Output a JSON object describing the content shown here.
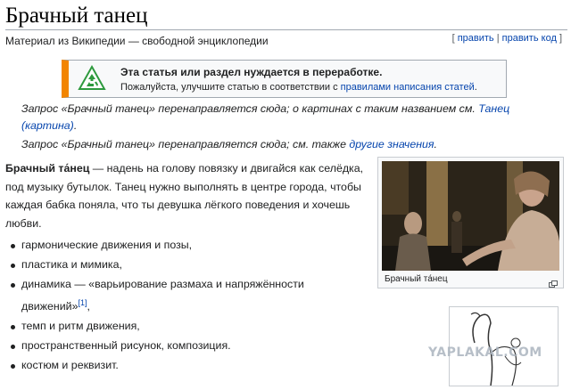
{
  "page": {
    "title": "Брачный танец",
    "subtitle": "Материал из Википедии — свободной энциклопедии"
  },
  "edit_links": {
    "open_bracket": "[",
    "edit": "править",
    "separator": "|",
    "edit_code": "править код",
    "close_bracket": "]"
  },
  "notice": {
    "icon": "recycle-icon",
    "heading": "Эта статья или раздел нуждается в переработке.",
    "body_prefix": "Пожалуйста, улучшите статью в соответствии с ",
    "body_link": "правилами написания статей",
    "body_suffix": ".",
    "accent_color": "#f28500"
  },
  "hatnotes": [
    {
      "line1_prefix": "Запрос «Брачный танец» перенаправляется сюда; о картинах с таким названием см. ",
      "line1_link": "Танец",
      "line2_link": "(картина)",
      "line2_suffix": "."
    },
    {
      "prefix": "Запрос «Брачный танец» перенаправляется сюда; см. также ",
      "link": "другие значения",
      "suffix": "."
    }
  ],
  "intro": {
    "bold": "Брачный та́нец",
    "text": " — надень на голову повязку и двигайся как селёдка, под музыку бутылок. Танец нужно выполнять в центре города, чтобы каждая бабка поняла, что ты девушка лёгкого поведения и хочешь любви."
  },
  "list": [
    {
      "text": "гармонические движения и позы,"
    },
    {
      "text": "пластика и мимика,"
    },
    {
      "text": "динамика — «варьирование размаха и напряжённости",
      "text2": "движений»",
      "ref": "[1]",
      "suffix": ","
    },
    {
      "text": "темп и ритм движения,"
    },
    {
      "text": "пространственный рисунок, композиция."
    },
    {
      "text": "костюм и реквизит."
    }
  ],
  "thumbnail": {
    "caption": "Брачный та́нец",
    "magnify_icon": "magnify-icon"
  },
  "watermark": "YAPLAKAL.COM",
  "colors": {
    "link": "#0645ad",
    "text": "#202122",
    "border": "#a2a9b1"
  }
}
